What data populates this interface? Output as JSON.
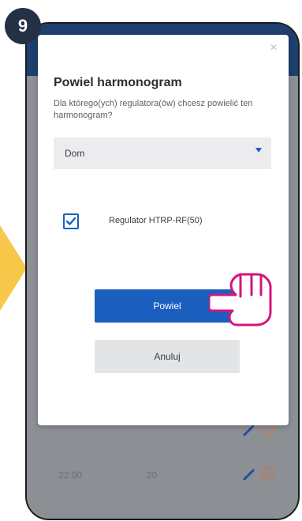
{
  "step": {
    "number": "9"
  },
  "dialog": {
    "close_glyph": "×",
    "title": "Powiel harmonogram",
    "description": "Dla którego(ych) regulatora(ów) chcesz powielić ten harmonogram?",
    "select": {
      "value": "Dom"
    },
    "checkbox": {
      "label": "Regulator HTRP-RF(50)",
      "checked": true
    },
    "primary_button": "Powiel",
    "secondary_button": "Anuluj"
  },
  "background_rows": [
    {
      "time": "22:00",
      "temp": "20"
    }
  ],
  "colors": {
    "accent": "#1b5fbe",
    "step_badge": "#243044",
    "highlight_arrow": "#f7c84a",
    "hand_outline": "#d6147a",
    "overlay": "#8c8f94"
  },
  "icons": [
    "close-icon",
    "chevron-down-icon",
    "checkmark-icon",
    "edit-pencil-icon",
    "remove-circle-icon",
    "pointing-hand-icon",
    "arrow-right-icon"
  ]
}
